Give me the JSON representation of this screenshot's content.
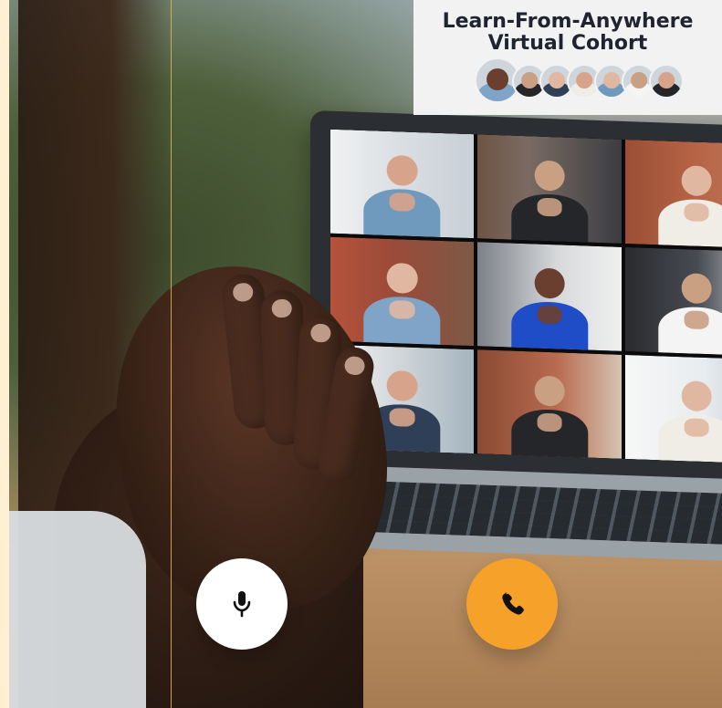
{
  "banner": {
    "title_line1": "Learn-From-Anywhere",
    "title_line2": "Virtual Cohort",
    "avatars": [
      {
        "name": "avatar-1"
      },
      {
        "name": "avatar-2"
      },
      {
        "name": "avatar-3"
      },
      {
        "name": "avatar-4"
      },
      {
        "name": "avatar-5"
      },
      {
        "name": "avatar-6"
      },
      {
        "name": "avatar-7"
      }
    ]
  },
  "controls": {
    "mic_button_icon": "microphone-icon",
    "call_button_icon": "phone-icon"
  },
  "colors": {
    "accent": "#f6a12a",
    "background_left": "#fff3df",
    "guide_line": "#e6b64a"
  }
}
